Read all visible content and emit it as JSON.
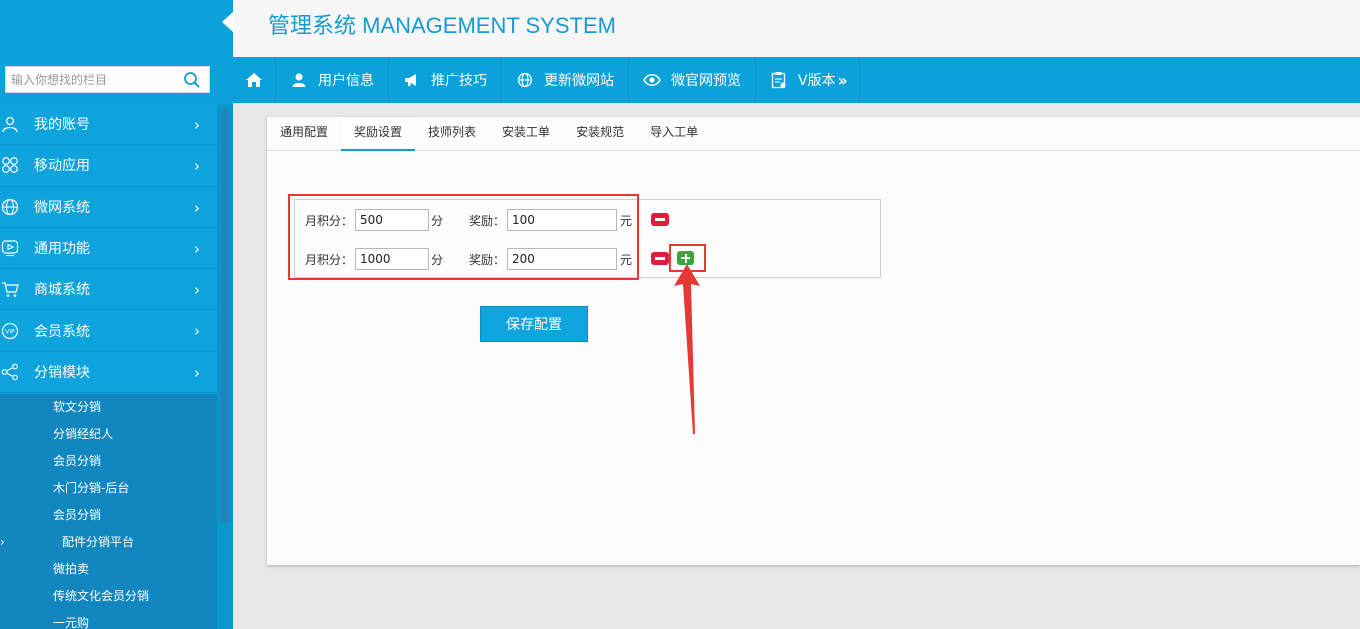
{
  "app": {
    "title": "管理系统 MANAGEMENT SYSTEM"
  },
  "sidebar": {
    "search": {
      "placeholder": "输入你想找的栏目",
      "icon": "search-icon"
    },
    "menu": [
      {
        "label": "我的账号",
        "icon": "user-icon"
      },
      {
        "label": "移动应用",
        "icon": "apps-icon"
      },
      {
        "label": "微网系统",
        "icon": "globe-icon"
      },
      {
        "label": "通用功能",
        "icon": "play-icon"
      },
      {
        "label": "商城系统",
        "icon": "cart-icon"
      },
      {
        "label": "会员系统",
        "icon": "vip-icon"
      },
      {
        "label": "分销模块",
        "icon": "share-icon"
      }
    ],
    "submenu": [
      {
        "label": "软文分销"
      },
      {
        "label": "分销经纪人"
      },
      {
        "label": "会员分销"
      },
      {
        "label": "木门分销-后台"
      },
      {
        "label": "会员分销"
      },
      {
        "label": "配件分销平台",
        "active": true
      },
      {
        "label": "微拍卖"
      },
      {
        "label": "传统文化会员分销"
      },
      {
        "label": "一元购"
      }
    ]
  },
  "topnav": {
    "items": [
      {
        "label": "用户信息",
        "icon": "user-icon"
      },
      {
        "label": "推广技巧",
        "icon": "megaphone-icon"
      },
      {
        "label": "更新微网站",
        "icon": "globe-icon"
      },
      {
        "label": "微官网预览",
        "icon": "eye-icon"
      },
      {
        "label": "V版本",
        "icon": "clipboard-icon"
      }
    ]
  },
  "tabs": [
    {
      "label": "通用配置"
    },
    {
      "label": "奖励设置",
      "active": true
    },
    {
      "label": "技师列表"
    },
    {
      "label": "安装工单"
    },
    {
      "label": "安装规范"
    },
    {
      "label": "导入工单"
    }
  ],
  "form": {
    "score_label": "月积分：",
    "score_unit": "分",
    "reward_label": "奖励：",
    "reward_unit": "元",
    "rows": [
      {
        "score": "500",
        "reward": "100"
      },
      {
        "score": "1000",
        "reward": "200"
      }
    ],
    "save_label": "保存配置"
  },
  "colors": {
    "accent": "#0ba2dc",
    "title": "#169bd5",
    "remove": "#e31c3d",
    "add": "#3aa63a",
    "annotation": "#e53935"
  }
}
